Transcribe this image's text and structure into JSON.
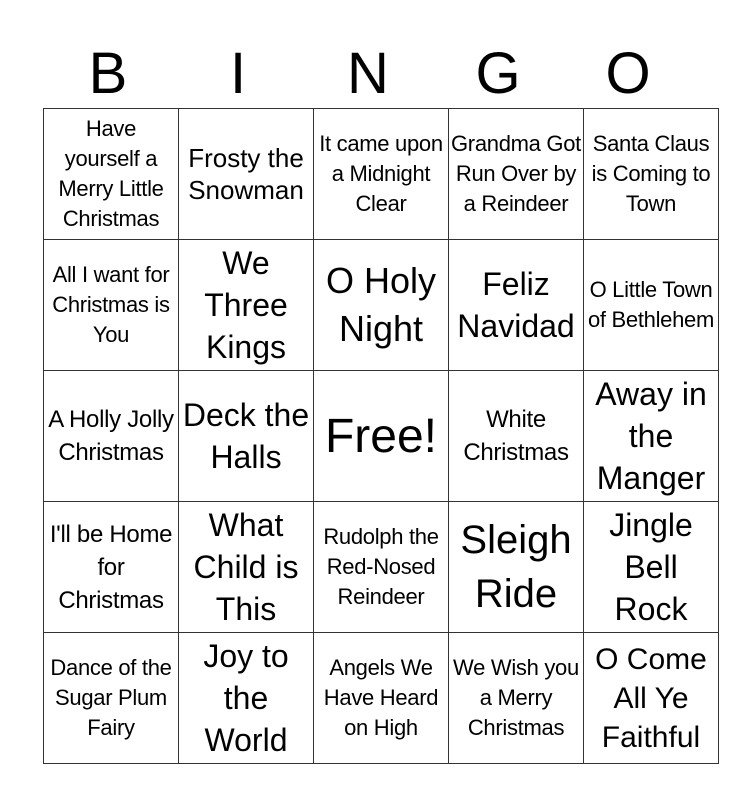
{
  "header": [
    "B",
    "I",
    "N",
    "G",
    "O"
  ],
  "rows": [
    [
      "Have yourself a Merry Little Christmas",
      "Frosty the Snowman",
      "It came upon a Midnight Clear",
      "Grandma Got Run Over by a Reindeer",
      "Santa Claus is Coming to Town"
    ],
    [
      "All I want for Christmas is You",
      "We Three Kings",
      "O Holy Night",
      "Feliz Navidad",
      "O Little Town of Bethlehem"
    ],
    [
      "A Holly Jolly Christmas",
      "Deck the Halls",
      "Free!",
      "White Christmas",
      "Away in the Manger"
    ],
    [
      "I'll be Home for Christmas",
      "What Child is This",
      "Rudolph the Red-Nosed Reindeer",
      "Sleigh Ride",
      "Jingle Bell Rock"
    ],
    [
      "Dance of the Sugar Plum Fairy",
      "Joy to the World",
      "Angels We Have Heard on High",
      "We Wish you a Merry Christmas",
      "O Come All Ye Faithful"
    ]
  ]
}
